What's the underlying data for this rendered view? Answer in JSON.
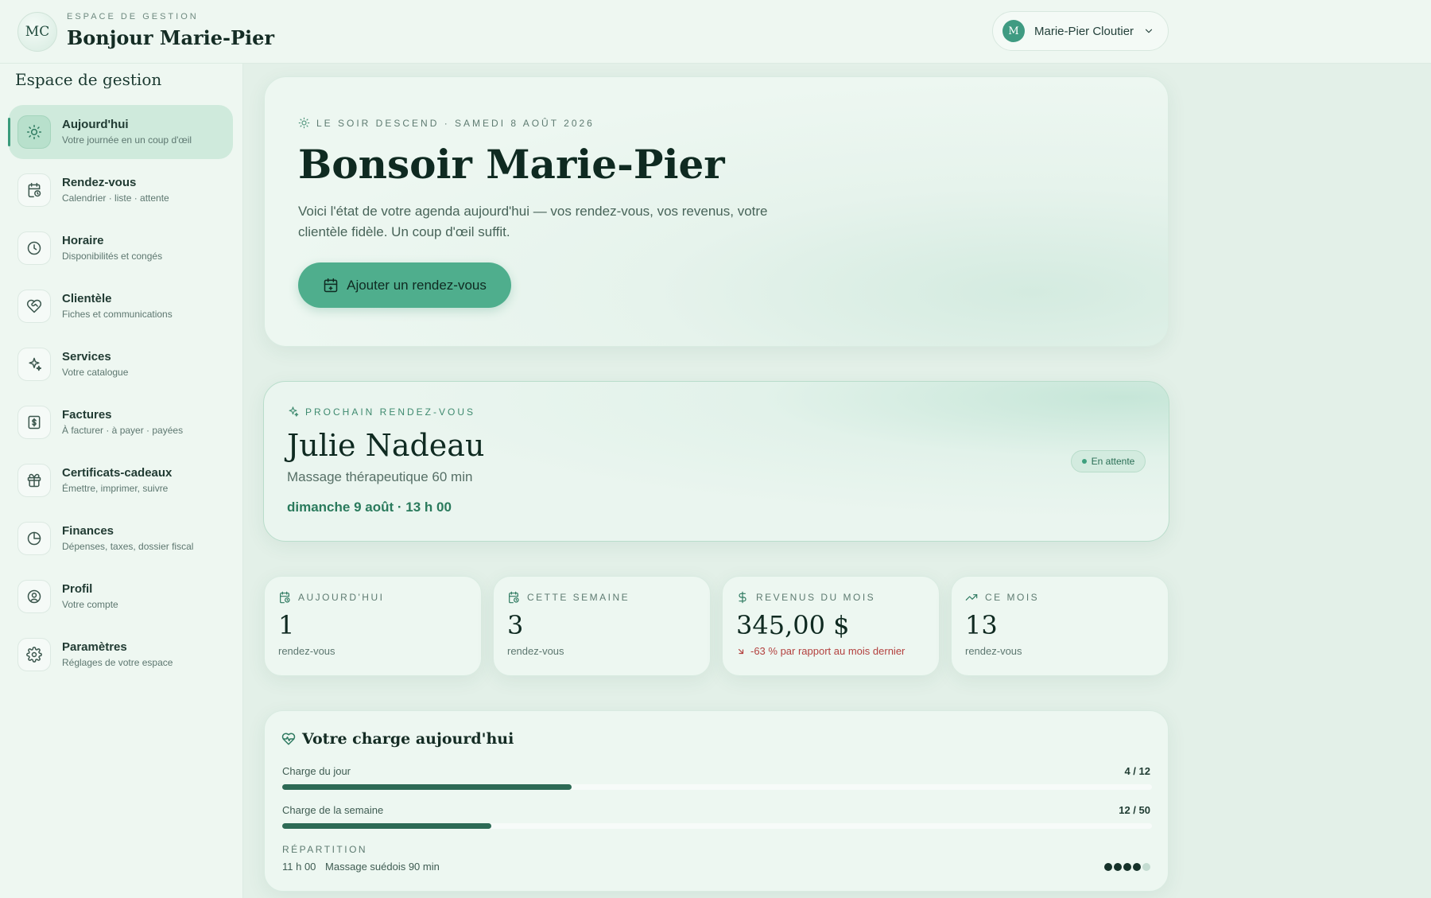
{
  "header": {
    "initials": "MC",
    "eyebrow": "ESPACE DE GESTION",
    "greeting": "Bonjour Marie-Pier",
    "user": {
      "initial": "M",
      "name": "Marie-Pier Cloutier"
    }
  },
  "sidebar": {
    "title": "Espace de gestion",
    "items": [
      {
        "label": "Aujourd'hui",
        "sub": "Votre journée en un coup d'œil",
        "icon": "sun-icon",
        "active": true
      },
      {
        "label": "Rendez-vous",
        "sub": "Calendrier · liste · attente",
        "icon": "calendar-clock-icon"
      },
      {
        "label": "Horaire",
        "sub": "Disponibilités et congés",
        "icon": "clock-icon"
      },
      {
        "label": "Clientèle",
        "sub": "Fiches et communications",
        "icon": "heart-handshake-icon"
      },
      {
        "label": "Services",
        "sub": "Votre catalogue",
        "icon": "sparkles-icon"
      },
      {
        "label": "Factures",
        "sub": "À facturer · à payer · payées",
        "icon": "receipt-dollar-icon"
      },
      {
        "label": "Certificats-cadeaux",
        "sub": "Émettre, imprimer, suivre",
        "icon": "gift-icon"
      },
      {
        "label": "Finances",
        "sub": "Dépenses, taxes, dossier fiscal",
        "icon": "pie-chart-icon"
      },
      {
        "label": "Profil",
        "sub": "Votre compte",
        "icon": "user-circle-icon"
      },
      {
        "label": "Paramètres",
        "sub": "Réglages de votre espace",
        "icon": "gear-icon"
      }
    ]
  },
  "hero": {
    "eyebrow": "LE SOIR DESCEND · SAMEDI 8 AOÛT 2026",
    "title": "Bonsoir Marie-Pier",
    "text": "Voici l'état de votre agenda aujourd'hui — vos rendez-vous, vos revenus, votre clientèle fidèle. Un coup d'œil suffit.",
    "button": "Ajouter un rendez-vous"
  },
  "next_appointment": {
    "eyebrow": "PROCHAIN RENDEZ-VOUS",
    "client": "Julie Nadeau",
    "service": "Massage thérapeutique 60 min",
    "datetime": "dimanche 9 août · 13 h 00",
    "status": "En attente"
  },
  "stats": [
    {
      "label": "AUJOURD'HUI",
      "value": "1",
      "sub": "rendez-vous",
      "icon": "calendar-clock-icon"
    },
    {
      "label": "CETTE SEMAINE",
      "value": "3",
      "sub": "rendez-vous",
      "icon": "calendar-clock-icon"
    },
    {
      "label": "REVENUS DU MOIS",
      "value": "345,00 $",
      "sub": "-63 % par rapport au mois dernier",
      "icon": "dollar-icon",
      "trend": "down"
    },
    {
      "label": "CE MOIS",
      "value": "13",
      "sub": "rendez-vous",
      "icon": "trending-up-icon"
    }
  ],
  "load": {
    "title": "Votre charge aujourd'hui",
    "day": {
      "label": "Charge du jour",
      "count": "4 / 12",
      "fraction": 0.333
    },
    "week": {
      "label": "Charge de la semaine",
      "count": "12 / 50",
      "fraction": 0.24
    },
    "breakdown_title": "RÉPARTITION",
    "breakdown": [
      {
        "time": "11 h 00",
        "service": "Massage suédois 90 min",
        "level": 4,
        "max": 5
      }
    ]
  },
  "colors": {
    "accent": "#4fae8d",
    "bar_fill": "#2d6a55",
    "negative": "#b3413f",
    "background": "#e3f0e8"
  }
}
